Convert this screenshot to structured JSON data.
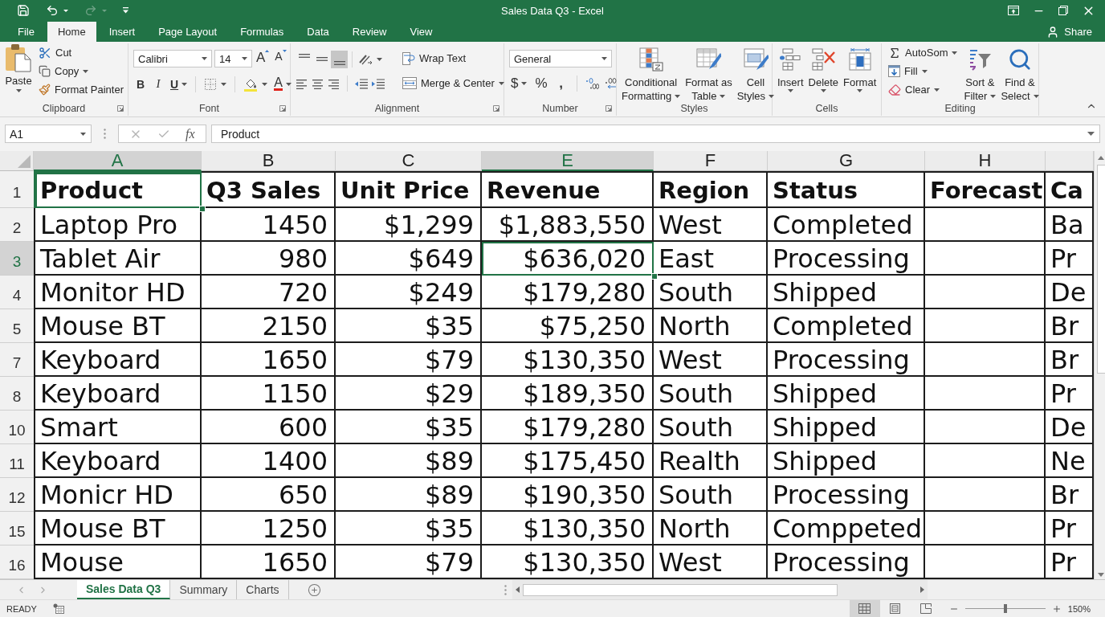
{
  "title_bar": {
    "title": "Sales Data Q3 - Excel"
  },
  "ribbon_tabs": [
    {
      "label": "File",
      "selected": false
    },
    {
      "label": "Home",
      "selected": true
    },
    {
      "label": "Insert",
      "selected": false
    },
    {
      "label": "Page Layout",
      "selected": false
    },
    {
      "label": "Formulas",
      "selected": false
    },
    {
      "label": "Data",
      "selected": false
    },
    {
      "label": "Review",
      "selected": false
    },
    {
      "label": "View",
      "selected": false
    }
  ],
  "share": "Share",
  "ribbon": {
    "clipboard": {
      "paste": "Paste",
      "cut": "Cut",
      "copy": "Copy",
      "format_painter": "Format Painter",
      "label": "Clipboard"
    },
    "font": {
      "font_name": "Calibri",
      "font_size": "14",
      "grow_font": "A",
      "shrink_font": "A",
      "bold": "B",
      "italic": "I",
      "underline": "U",
      "font_color": "A",
      "label": "Font"
    },
    "alignment": {
      "vertical": [
        {
          "selected": false
        },
        {
          "selected": false
        },
        {
          "selected": true
        }
      ],
      "wrap_text": "Wrap Text",
      "merge_center": "Merge & Center",
      "label": "Alignment"
    },
    "number": {
      "format": "General",
      "currency": "$",
      "percent": "%",
      "comma": ",",
      "label": "Number"
    },
    "styles": {
      "buttons": [
        {
          "kind": "conditional",
          "lines": [
            "Conditional",
            "Formatting"
          ]
        },
        {
          "kind": "table",
          "lines": [
            "Format as",
            "Table"
          ]
        },
        {
          "kind": "cell_styles",
          "lines": [
            "Cell",
            "Styles"
          ]
        }
      ],
      "label": "Styles"
    },
    "cells": {
      "buttons": [
        {
          "kind": "insert",
          "label": "Insert"
        },
        {
          "kind": "delete",
          "label": "Delete"
        },
        {
          "kind": "format",
          "label": "Format"
        }
      ],
      "label": "Cells"
    },
    "editing": {
      "autosum": "AutoSom",
      "fill": "Fill",
      "clear": "Clear",
      "sort_filter": [
        "Sort &",
        "Filter"
      ],
      "find_select": [
        "Find &",
        "Select"
      ],
      "label": "Editing"
    }
  },
  "formula_bar": {
    "name_box": "A1",
    "function_button": "fx",
    "formula": "Product"
  },
  "sheet": {
    "columns": [
      {
        "letter": "A",
        "selected": true,
        "kind": "text"
      },
      {
        "letter": "B",
        "selected": false,
        "kind": "number"
      },
      {
        "letter": "C",
        "selected": false,
        "kind": "number"
      },
      {
        "letter": "E",
        "selected": true,
        "kind": "number"
      },
      {
        "letter": "F",
        "selected": false,
        "kind": "text"
      },
      {
        "letter": "G",
        "selected": false,
        "kind": "text"
      },
      {
        "letter": "H",
        "selected": false,
        "kind": "text"
      },
      {
        "selected": false,
        "kind": "text"
      }
    ],
    "rows": [
      {
        "number": "1",
        "selected": false,
        "kind": "header",
        "cells": [
          {
            "text": "Product",
            "selected": true
          },
          {
            "text": "Q3 Sales",
            "selected": false
          },
          {
            "text": "Unit Price",
            "selected": false
          },
          {
            "text": "Revenue",
            "selected": false
          },
          {
            "text": "Region",
            "selected": false
          },
          {
            "text": "Status",
            "selected": false
          },
          {
            "text": "Forecast",
            "selected": false
          },
          {
            "text": "Ca",
            "selected": false
          }
        ]
      },
      {
        "number": "2",
        "selected": false,
        "kind": "data",
        "cells": [
          {
            "text": "Laptop Pro",
            "selected": false
          },
          {
            "text": "1450",
            "selected": false
          },
          {
            "text": "$1,299",
            "selected": false
          },
          {
            "text": "$1,883,550",
            "selected": false
          },
          {
            "text": "West",
            "selected": false
          },
          {
            "text": "Completed",
            "selected": false
          },
          {
            "selected": false
          },
          {
            "text": "Ba",
            "selected": false
          }
        ]
      },
      {
        "number": "3",
        "selected": true,
        "kind": "data",
        "cells": [
          {
            "text": "Tablet Air",
            "selected": false
          },
          {
            "text": "980",
            "selected": false
          },
          {
            "text": "$649",
            "selected": false
          },
          {
            "text": "$636,020",
            "selected": true
          },
          {
            "text": "East",
            "selected": false
          },
          {
            "text": "Processing",
            "selected": false
          },
          {
            "selected": false
          },
          {
            "text": "Pr",
            "selected": false
          }
        ]
      },
      {
        "number": "4",
        "selected": false,
        "kind": "data",
        "cells": [
          {
            "text": "Monitor HD",
            "selected": false
          },
          {
            "text": "720",
            "selected": false
          },
          {
            "text": "$249",
            "selected": false
          },
          {
            "text": "$179,280",
            "selected": false
          },
          {
            "text": "South",
            "selected": false
          },
          {
            "text": "Shipped",
            "selected": false
          },
          {
            "selected": false
          },
          {
            "text": "De",
            "selected": false
          }
        ]
      },
      {
        "number": "5",
        "selected": false,
        "kind": "data",
        "cells": [
          {
            "text": "Mouse BT",
            "selected": false
          },
          {
            "text": "2150",
            "selected": false
          },
          {
            "text": "$35",
            "selected": false
          },
          {
            "text": "$75,250",
            "selected": false
          },
          {
            "text": "North",
            "selected": false
          },
          {
            "text": "Completed",
            "selected": false
          },
          {
            "selected": false
          },
          {
            "text": "Br",
            "selected": false
          }
        ]
      },
      {
        "number": "7",
        "selected": false,
        "kind": "data",
        "cells": [
          {
            "text": "Keyboard",
            "selected": false
          },
          {
            "text": "1650",
            "selected": false
          },
          {
            "text": "$79",
            "selected": false
          },
          {
            "text": "$130,350",
            "selected": false
          },
          {
            "text": "West",
            "selected": false
          },
          {
            "text": "Processing",
            "selected": false
          },
          {
            "selected": false
          },
          {
            "text": "Br",
            "selected": false
          }
        ]
      },
      {
        "number": "8",
        "selected": false,
        "kind": "data",
        "cells": [
          {
            "text": "Keyboard",
            "selected": false
          },
          {
            "text": "1150",
            "selected": false
          },
          {
            "text": "$29",
            "selected": false
          },
          {
            "text": "$189,350",
            "selected": false
          },
          {
            "text": "South",
            "selected": false
          },
          {
            "text": "Shipped",
            "selected": false
          },
          {
            "selected": false
          },
          {
            "text": "Pr",
            "selected": false
          }
        ]
      },
      {
        "number": "10",
        "selected": false,
        "kind": "data",
        "cells": [
          {
            "text": "Smart",
            "selected": false
          },
          {
            "text": "600",
            "selected": false
          },
          {
            "text": "$35",
            "selected": false
          },
          {
            "text": "$179,280",
            "selected": false
          },
          {
            "text": "South",
            "selected": false
          },
          {
            "text": "Shipped",
            "selected": false
          },
          {
            "selected": false
          },
          {
            "text": "De",
            "selected": false
          }
        ]
      },
      {
        "number": "11",
        "selected": false,
        "kind": "data",
        "cells": [
          {
            "text": "Keyboard",
            "selected": false
          },
          {
            "text": "1400",
            "selected": false
          },
          {
            "text": "$89",
            "selected": false
          },
          {
            "text": "$175,450",
            "selected": false
          },
          {
            "text": "Realth",
            "selected": false
          },
          {
            "text": "Shipped",
            "selected": false
          },
          {
            "selected": false
          },
          {
            "text": "Ne",
            "selected": false
          }
        ]
      },
      {
        "number": "12",
        "selected": false,
        "kind": "data",
        "cells": [
          {
            "text": "Monicr HD",
            "selected": false
          },
          {
            "text": "650",
            "selected": false
          },
          {
            "text": "$89",
            "selected": false
          },
          {
            "text": "$190,350",
            "selected": false
          },
          {
            "text": "South",
            "selected": false
          },
          {
            "text": "Processing",
            "selected": false
          },
          {
            "selected": false
          },
          {
            "text": "Br",
            "selected": false
          }
        ]
      },
      {
        "number": "15",
        "selected": false,
        "kind": "data",
        "cells": [
          {
            "text": "Mouse BT",
            "selected": false
          },
          {
            "text": "1250",
            "selected": false
          },
          {
            "text": "$35",
            "selected": false
          },
          {
            "text": "$130,350",
            "selected": false
          },
          {
            "text": "North",
            "selected": false
          },
          {
            "text": "Comppeted",
            "selected": false
          },
          {
            "selected": false
          },
          {
            "text": "Pr",
            "selected": false
          }
        ]
      },
      {
        "number": "16",
        "selected": false,
        "kind": "data",
        "cells": [
          {
            "text": "Mouse",
            "selected": false
          },
          {
            "text": "1650",
            "selected": false
          },
          {
            "text": "$79",
            "selected": false
          },
          {
            "text": "$130,350",
            "selected": false
          },
          {
            "text": "West",
            "selected": false
          },
          {
            "text": "Processing",
            "selected": false
          },
          {
            "selected": false
          },
          {
            "text": "Pr",
            "selected": false
          }
        ]
      }
    ]
  },
  "sheet_tabs": [
    {
      "label": "Sales Data Q3",
      "selected": true
    },
    {
      "label": "Summary",
      "selected": false
    },
    {
      "label": "Charts",
      "selected": false
    }
  ],
  "status_bar": {
    "mode": "READY",
    "views": [
      {
        "selected": true
      },
      {
        "selected": false
      },
      {
        "selected": false
      }
    ],
    "zoom": {
      "level": 0.5,
      "reading": "150%"
    }
  }
}
